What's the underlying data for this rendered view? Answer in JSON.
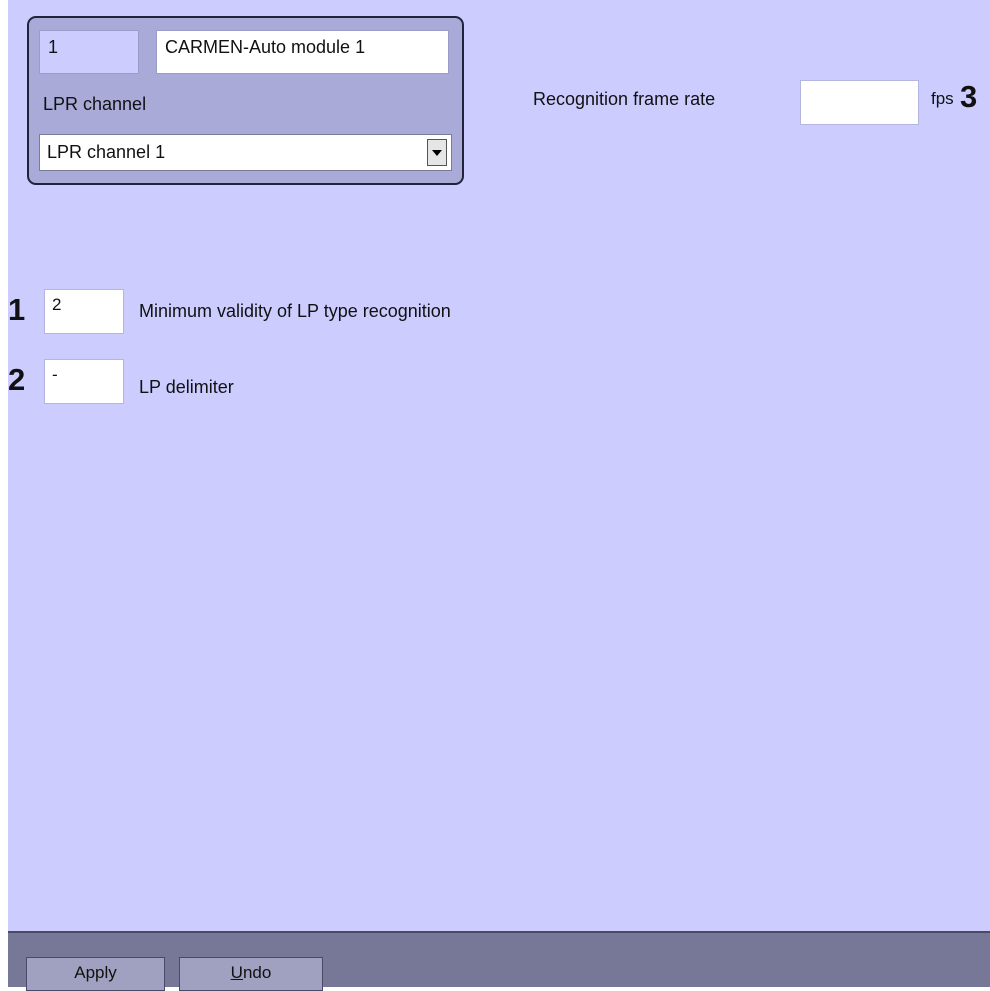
{
  "module": {
    "id": "1",
    "name": "CARMEN-Auto module 1",
    "channel_label": "LPR channel",
    "channel_selected": "LPR channel 1"
  },
  "recognition": {
    "frame_rate_label": "Recognition frame rate",
    "frame_rate_value": "",
    "unit": "fps"
  },
  "callouts": {
    "one": "1",
    "two": "2",
    "three": "3"
  },
  "params": {
    "min_validity_value": "2",
    "min_validity_label": "Minimum validity of LP type recognition",
    "delimiter_value": "-",
    "delimiter_label": "LP delimiter"
  },
  "buttons": {
    "apply": "Apply",
    "undo": "Undo"
  }
}
